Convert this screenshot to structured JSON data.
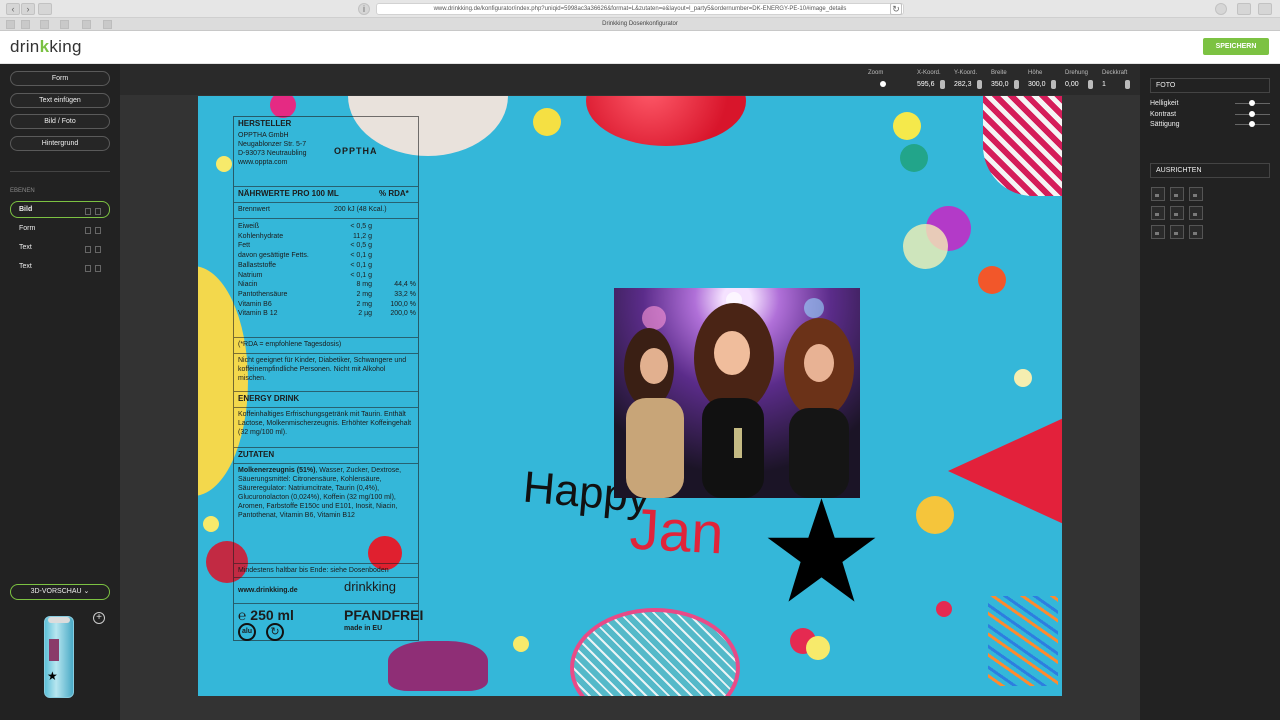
{
  "browser": {
    "url": "www.drinkking.de/konfigurator/index.php?uniqid=5998ac3a36626&format=L&zutaten=e&layout=l_party5&ordernumber=DK-ENERGY-PE-10#image_details",
    "tab_title": "Drinkking Dosenkonfigurator"
  },
  "header": {
    "logo_before": "drin",
    "logo_mark": "k",
    "logo_after": "king",
    "save_label": "SPEICHERN"
  },
  "sidebar": {
    "buttons": [
      "Form",
      "Text einfügen",
      "Bild / Foto",
      "Hintergrund"
    ],
    "layers_heading": "EBENEN",
    "layers": [
      "Bild",
      "Form",
      "Text",
      "Text"
    ],
    "preview_label": "3D-VORSCHAU",
    "preview_chevron": "⌄",
    "add_label": "+"
  },
  "toolbar": {
    "zoom_label": "Zoom",
    "x_label": "X-Koord.",
    "x_value": "595,6",
    "y_label": "Y-Koord.",
    "y_value": "282,3",
    "w_label": "Breite",
    "w_value": "350,0",
    "h_label": "Höhe",
    "h_value": "300,0",
    "rot_label": "Drehung",
    "rot_value": "0,00",
    "op_label": "Deckkraft",
    "op_value": "1"
  },
  "label": {
    "maker_head": "HERSTELLER",
    "maker_lines": "OPPTHA GmbH\nNeugablonzer Str. 5-7\nD-93073 Neutraubling\nwww.oppta.com",
    "maker_logo": "OPPTHA",
    "nutri_head": "NÄHRWERTE PRO 100 ML",
    "rda_head": "% RDA*",
    "energy_label": "Brennwert",
    "energy_value": "200 kJ (48 Kcal.)",
    "rows_names": "Eiweiß\nKohlenhydrate\nFett\ndavon gesättigte Fetts.\nBallaststoffe\nNatrium\nNiacin\nPantothensäure\nVitamin B6\nVitamin B 12",
    "rows_values": "< 0,5 g\n11,2 g\n< 0,5 g\n< 0,1 g\n< 0,1 g\n< 0,1 g\n8 mg\n2 mg\n2 mg\n2 µg",
    "rows_rda": "\n\n\n\n\n\n44,4 %\n33,2 %\n100,0 %\n200,0 %",
    "rda_note": "(*RDA = empfohlene Tagesdosis)",
    "warning": "Nicht geeignet für Kinder, Diabetiker, Schwangere und koffeinempfindliche Personen. Nicht mit Alkohol mischen.",
    "energy_drink_head": "ENERGY DRINK",
    "energy_drink_text": "Koffeinhaltiges Erfrischungsgetränk mit Taurin. Enthält Lactose, Molkenmischerzeugnis. Erhöhter Koffeingehalt (32 mg/100 ml).",
    "zutaten_head": "ZUTATEN",
    "zutaten_bold": "Molkenerzeugnis (51%)",
    "zutaten_text": ", Wasser, Zucker, Dextrose, Säuerungsmittel: Citronensäure, Kohlensäure, Säureregulator: Natriumcitrate, Taurin (0,4%), Glucuronolacton (0,024%), Koffein (32 mg/100 ml), Aromen, Farbstoffe E150c und E101, Inosit, Niacin, Pantothenat, Vitamin B6, Vitamin B12",
    "best_before": "Mindestens haltbar bis Ende: siehe Dosenboden",
    "site": "www.drinkking.de",
    "brand": "drinkking",
    "volume": "℮ 250 ml",
    "pfand": "PFANDFREI",
    "made_in": "made in EU",
    "alu": "alu",
    "recycle": "↻"
  },
  "canvas": {
    "happy": "Happy",
    "jan": "Jan"
  },
  "right_panel": {
    "foto_label": "FOTO",
    "brightness": "Helligkeit",
    "contrast": "Kontrast",
    "saturation": "Sättigung",
    "align_label": "AUSRICHTEN"
  },
  "colors": {
    "accent": "#7cc242",
    "canvas_bg": "#34b7d9",
    "jan_red": "#e0243a"
  }
}
